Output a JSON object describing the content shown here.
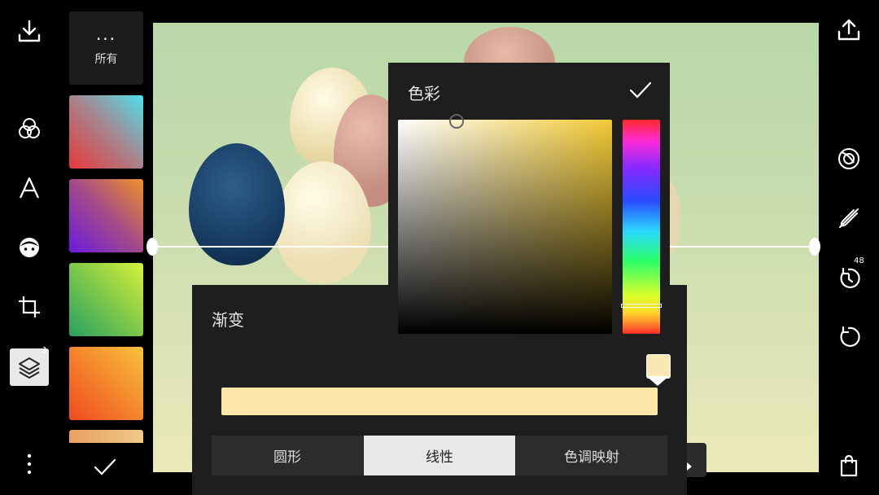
{
  "left_toolbar": {
    "download_icon": "download-icon",
    "blend_icon": "blend-circles-icon",
    "text_icon": "text-icon",
    "face_icon": "face-icon",
    "crop_icon": "crop-icon",
    "layers_icon": "layers-icon",
    "layers_badge": "1",
    "more_icon": "more-vertical-icon"
  },
  "presets": {
    "all_dots": "···",
    "all_label": "所有",
    "confirm_icon": "check-icon",
    "swatches": [
      {
        "from": "#e8383b",
        "to": "#4fe0ee"
      },
      {
        "from": "#6a1be0",
        "to": "#f0922a"
      },
      {
        "from": "#28a060",
        "to": "#d6f23a"
      },
      {
        "from": "#f04a1f",
        "to": "#f8c23c"
      }
    ]
  },
  "right_toolbar": {
    "share_icon": "share-upload-icon",
    "lens_icon": "lens-icon",
    "brush_icon": "brush-off-icon",
    "history_icon": "history-icon",
    "history_count": "48",
    "reset_icon": "reset-icon",
    "bag_icon": "shopping-bag-icon"
  },
  "color_picker": {
    "title": "色彩",
    "confirm_icon": "check-icon",
    "selected_color": "#fce8a8",
    "hue_marker": "yellow"
  },
  "gradient_panel": {
    "title": "渐变",
    "stop_color": "#fbe7b3",
    "bar_color": "#fce7a9",
    "modes": [
      "圆形",
      "线性",
      "色调映射"
    ],
    "active_mode": "线性"
  }
}
